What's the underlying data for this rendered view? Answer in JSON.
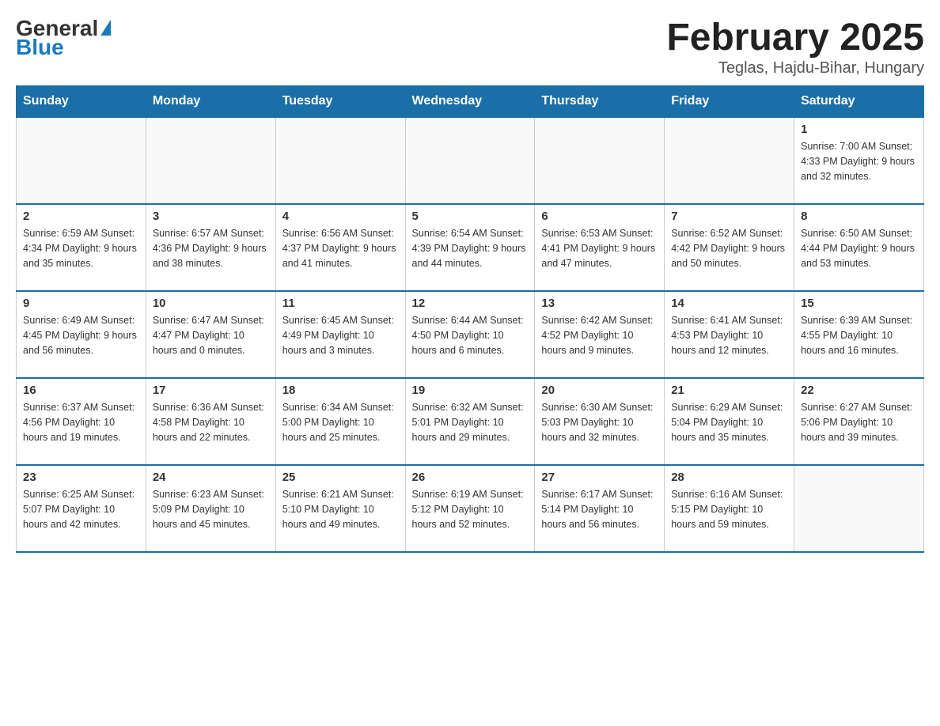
{
  "header": {
    "logo_general": "General",
    "logo_blue": "Blue",
    "month_title": "February 2025",
    "location": "Teglas, Hajdu-Bihar, Hungary"
  },
  "weekdays": [
    "Sunday",
    "Monday",
    "Tuesday",
    "Wednesday",
    "Thursday",
    "Friday",
    "Saturday"
  ],
  "weeks": [
    [
      {
        "day": "",
        "info": ""
      },
      {
        "day": "",
        "info": ""
      },
      {
        "day": "",
        "info": ""
      },
      {
        "day": "",
        "info": ""
      },
      {
        "day": "",
        "info": ""
      },
      {
        "day": "",
        "info": ""
      },
      {
        "day": "1",
        "info": "Sunrise: 7:00 AM\nSunset: 4:33 PM\nDaylight: 9 hours and 32 minutes."
      }
    ],
    [
      {
        "day": "2",
        "info": "Sunrise: 6:59 AM\nSunset: 4:34 PM\nDaylight: 9 hours and 35 minutes."
      },
      {
        "day": "3",
        "info": "Sunrise: 6:57 AM\nSunset: 4:36 PM\nDaylight: 9 hours and 38 minutes."
      },
      {
        "day": "4",
        "info": "Sunrise: 6:56 AM\nSunset: 4:37 PM\nDaylight: 9 hours and 41 minutes."
      },
      {
        "day": "5",
        "info": "Sunrise: 6:54 AM\nSunset: 4:39 PM\nDaylight: 9 hours and 44 minutes."
      },
      {
        "day": "6",
        "info": "Sunrise: 6:53 AM\nSunset: 4:41 PM\nDaylight: 9 hours and 47 minutes."
      },
      {
        "day": "7",
        "info": "Sunrise: 6:52 AM\nSunset: 4:42 PM\nDaylight: 9 hours and 50 minutes."
      },
      {
        "day": "8",
        "info": "Sunrise: 6:50 AM\nSunset: 4:44 PM\nDaylight: 9 hours and 53 minutes."
      }
    ],
    [
      {
        "day": "9",
        "info": "Sunrise: 6:49 AM\nSunset: 4:45 PM\nDaylight: 9 hours and 56 minutes."
      },
      {
        "day": "10",
        "info": "Sunrise: 6:47 AM\nSunset: 4:47 PM\nDaylight: 10 hours and 0 minutes."
      },
      {
        "day": "11",
        "info": "Sunrise: 6:45 AM\nSunset: 4:49 PM\nDaylight: 10 hours and 3 minutes."
      },
      {
        "day": "12",
        "info": "Sunrise: 6:44 AM\nSunset: 4:50 PM\nDaylight: 10 hours and 6 minutes."
      },
      {
        "day": "13",
        "info": "Sunrise: 6:42 AM\nSunset: 4:52 PM\nDaylight: 10 hours and 9 minutes."
      },
      {
        "day": "14",
        "info": "Sunrise: 6:41 AM\nSunset: 4:53 PM\nDaylight: 10 hours and 12 minutes."
      },
      {
        "day": "15",
        "info": "Sunrise: 6:39 AM\nSunset: 4:55 PM\nDaylight: 10 hours and 16 minutes."
      }
    ],
    [
      {
        "day": "16",
        "info": "Sunrise: 6:37 AM\nSunset: 4:56 PM\nDaylight: 10 hours and 19 minutes."
      },
      {
        "day": "17",
        "info": "Sunrise: 6:36 AM\nSunset: 4:58 PM\nDaylight: 10 hours and 22 minutes."
      },
      {
        "day": "18",
        "info": "Sunrise: 6:34 AM\nSunset: 5:00 PM\nDaylight: 10 hours and 25 minutes."
      },
      {
        "day": "19",
        "info": "Sunrise: 6:32 AM\nSunset: 5:01 PM\nDaylight: 10 hours and 29 minutes."
      },
      {
        "day": "20",
        "info": "Sunrise: 6:30 AM\nSunset: 5:03 PM\nDaylight: 10 hours and 32 minutes."
      },
      {
        "day": "21",
        "info": "Sunrise: 6:29 AM\nSunset: 5:04 PM\nDaylight: 10 hours and 35 minutes."
      },
      {
        "day": "22",
        "info": "Sunrise: 6:27 AM\nSunset: 5:06 PM\nDaylight: 10 hours and 39 minutes."
      }
    ],
    [
      {
        "day": "23",
        "info": "Sunrise: 6:25 AM\nSunset: 5:07 PM\nDaylight: 10 hours and 42 minutes."
      },
      {
        "day": "24",
        "info": "Sunrise: 6:23 AM\nSunset: 5:09 PM\nDaylight: 10 hours and 45 minutes."
      },
      {
        "day": "25",
        "info": "Sunrise: 6:21 AM\nSunset: 5:10 PM\nDaylight: 10 hours and 49 minutes."
      },
      {
        "day": "26",
        "info": "Sunrise: 6:19 AM\nSunset: 5:12 PM\nDaylight: 10 hours and 52 minutes."
      },
      {
        "day": "27",
        "info": "Sunrise: 6:17 AM\nSunset: 5:14 PM\nDaylight: 10 hours and 56 minutes."
      },
      {
        "day": "28",
        "info": "Sunrise: 6:16 AM\nSunset: 5:15 PM\nDaylight: 10 hours and 59 minutes."
      },
      {
        "day": "",
        "info": ""
      }
    ]
  ]
}
